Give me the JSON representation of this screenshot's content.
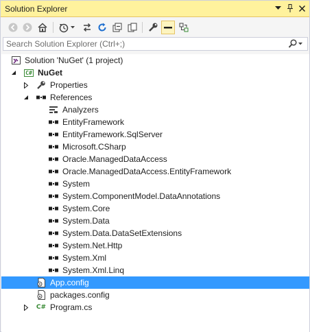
{
  "window": {
    "title": "Solution Explorer",
    "title_buttons": [
      "dropdown-arrow-icon",
      "pin-icon",
      "close-icon"
    ]
  },
  "toolbar": {
    "tools": [
      "back-icon",
      "forward-icon",
      "home-icon",
      "history-icon",
      "sync-icon",
      "refresh-icon",
      "collapse-all-icon",
      "copy-icon",
      "properties-icon",
      "preview-icon",
      "view-switch-icon"
    ]
  },
  "search": {
    "placeholder": "Search Solution Explorer (Ctrl+;)",
    "value": ""
  },
  "tree": {
    "solution_label": "Solution 'NuGet' (1 project)",
    "project_label": "NuGet",
    "properties_label": "Properties",
    "references_label": "References",
    "references": [
      "Analyzers",
      "EntityFramework",
      "EntityFramework.SqlServer",
      "Microsoft.CSharp",
      "Oracle.ManagedDataAccess",
      "Oracle.ManagedDataAccess.EntityFramework",
      "System",
      "System.ComponentModel.DataAnnotations",
      "System.Core",
      "System.Data",
      "System.Data.DataSetExtensions",
      "System.Net.Http",
      "System.Xml",
      "System.Xml.Linq"
    ],
    "files": [
      {
        "label": "App.config",
        "selected": true
      },
      {
        "label": "packages.config",
        "selected": false
      },
      {
        "label": "Program.cs",
        "selected": false
      }
    ]
  },
  "colors": {
    "title_bar": "#fff29d",
    "selection": "#3399ff",
    "tree_background": "#ffffff"
  }
}
